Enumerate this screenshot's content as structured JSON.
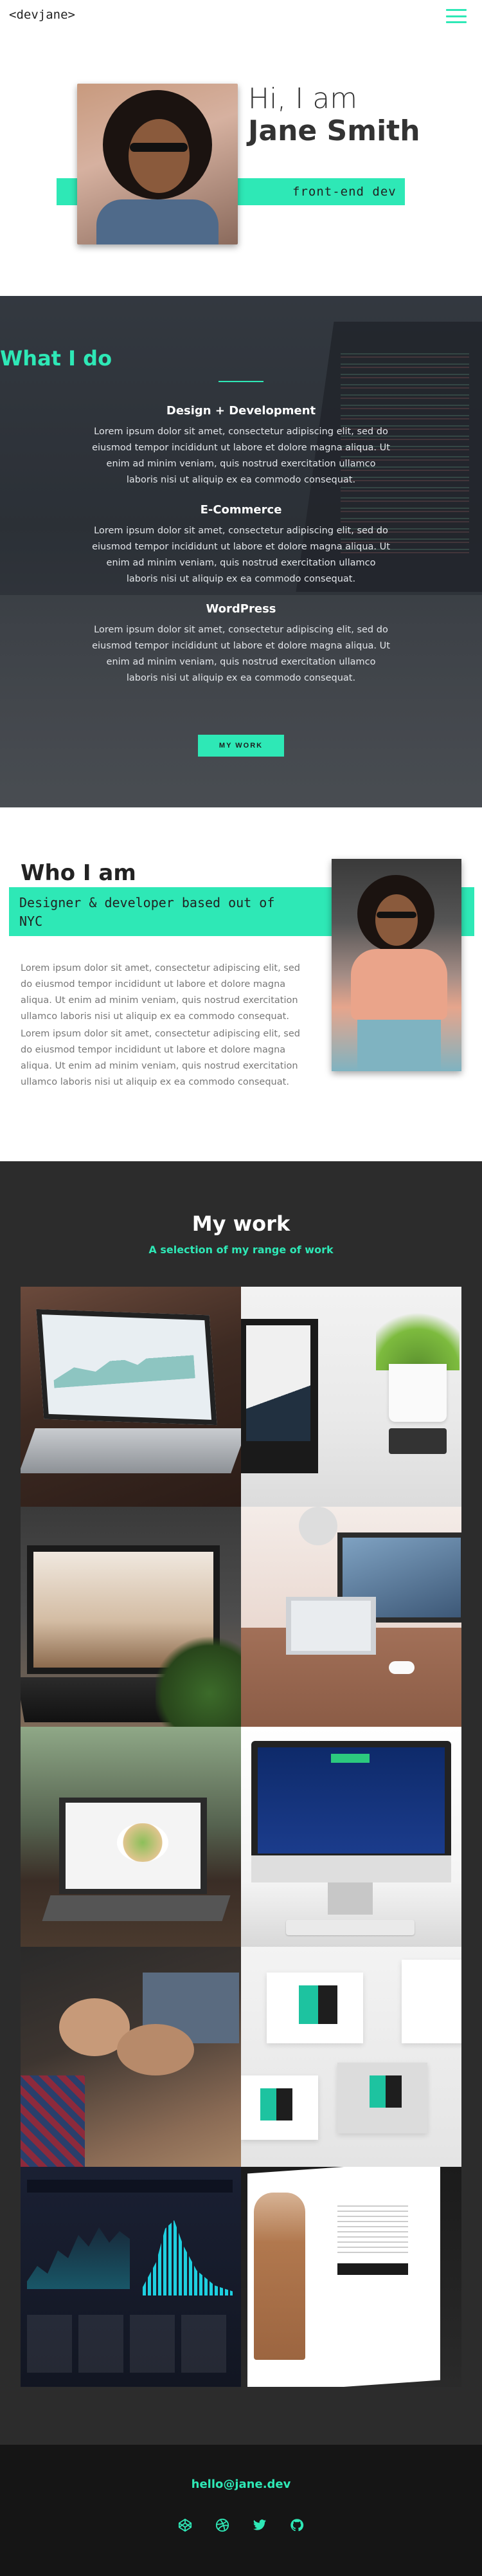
{
  "header": {
    "logo": "<devjane>",
    "menu_icon": "hamburger-icon"
  },
  "hero": {
    "greeting": "Hi, I am",
    "name": "Jane Smith",
    "role": "front-end dev"
  },
  "what_i_do": {
    "title": "What I do",
    "services": [
      {
        "title": "Design + Development",
        "text": "Lorem ipsum dolor sit amet, consectetur adipiscing elit, sed do eiusmod tempor incididunt ut labore et dolore magna aliqua. Ut enim ad minim veniam, quis nostrud exercitation ullamco laboris nisi ut aliquip ex ea commodo consequat."
      },
      {
        "title": "E-Commerce",
        "text": "Lorem ipsum dolor sit amet, consectetur adipiscing elit, sed do eiusmod tempor incididunt ut labore et dolore magna aliqua. Ut enim ad minim veniam, quis nostrud exercitation ullamco laboris nisi ut aliquip ex ea commodo consequat."
      },
      {
        "title": "WordPress",
        "text": "Lorem ipsum dolor sit amet, consectetur adipiscing elit, sed do eiusmod tempor incididunt ut labore et dolore magna aliqua. Ut enim ad minim veniam, quis nostrud exercitation ullamco laboris nisi ut aliquip ex ea commodo consequat."
      }
    ],
    "button_label": "MY WORK"
  },
  "who_i_am": {
    "title": "Who I am",
    "subtitle": "Designer & developer based out of NYC",
    "paragraphs": [
      "Lorem ipsum dolor sit amet, consectetur adipiscing elit, sed do eiusmod tempor incididunt ut labore et dolore magna aliqua. Ut enim ad minim veniam, quis nostrud exercitation ullamco laboris nisi ut aliquip ex ea commodo consequat.",
      "Lorem ipsum dolor sit amet, consectetur adipiscing elit, sed do eiusmod tempor incididunt ut labore et dolore magna aliqua. Ut enim ad minim veniam, quis nostrud exercitation ullamco laboris nisi ut aliquip ex ea commodo consequat."
    ]
  },
  "my_work": {
    "title": "My work",
    "subtitle": "A selection of my range of work"
  },
  "footer": {
    "email": "hello@jane.dev",
    "social_icons": [
      "codepen-icon",
      "dribbble-icon",
      "twitter-icon",
      "github-icon"
    ]
  },
  "colors": {
    "accent": "#2ee8b6",
    "dark": "#2c2c2c",
    "footer": "#151515",
    "text": "#333333"
  }
}
